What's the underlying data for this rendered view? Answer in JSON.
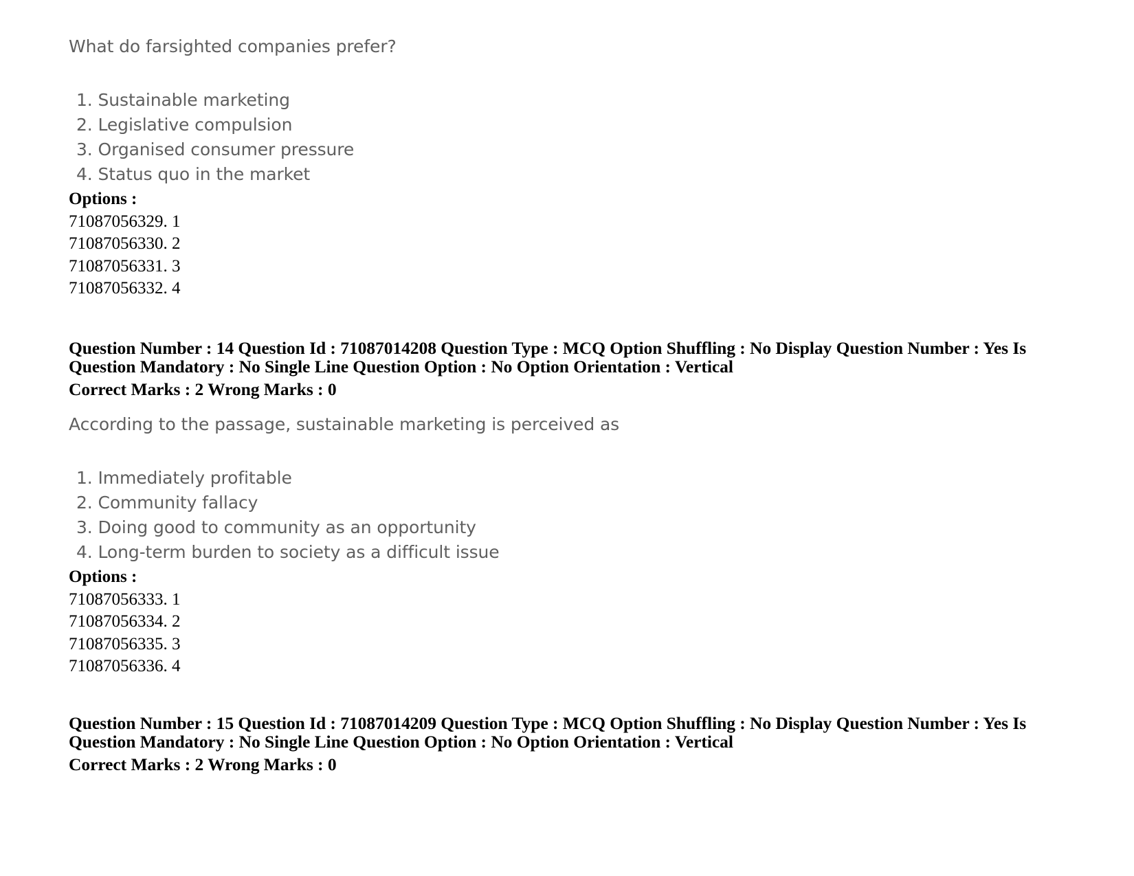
{
  "document": {
    "questions": [
      {
        "stem": "What do farsighted companies prefer?",
        "choices": [
          "1. Sustainable marketing",
          "2. Legislative compulsion",
          "3. Organised consumer pressure",
          "4. Status quo in the market"
        ],
        "options_label": "Options :",
        "option_ids": [
          "71087056329. 1",
          "71087056330. 2",
          "71087056331. 3",
          "71087056332. 4"
        ]
      },
      {
        "stem": "According to the passage, sustainable marketing is perceived as",
        "choices": [
          "1. Immediately profitable",
          "2. Community fallacy",
          "3. Doing good to community as an opportunity",
          "4. Long-term burden to society as a difficult issue"
        ],
        "options_label": "Options :",
        "option_ids": [
          "71087056333. 1",
          "71087056334. 2",
          "71087056335. 3",
          "71087056336. 4"
        ]
      }
    ],
    "meta_blocks": [
      {
        "line1": "Question Number : 14 Question Id : 71087014208 Question Type : MCQ Option Shuffling : No Display Question Number : Yes Is Question Mandatory : No Single Line Question Option : No Option Orientation : Vertical",
        "line2": "Correct Marks : 2 Wrong Marks : 0",
        "fields": {
          "question_number": "14",
          "question_id": "71087014208",
          "question_type": "MCQ",
          "option_shuffling": "No",
          "display_question_number": "Yes",
          "is_question_mandatory": "No",
          "single_line_question_option": "No",
          "option_orientation": "Vertical",
          "correct_marks": "2",
          "wrong_marks": "0"
        }
      },
      {
        "line1": "Question Number : 15 Question Id : 71087014209 Question Type : MCQ Option Shuffling : No Display Question Number : Yes Is Question Mandatory : No Single Line Question Option : No Option Orientation : Vertical",
        "line2": "Correct Marks : 2 Wrong Marks : 0",
        "fields": {
          "question_number": "15",
          "question_id": "71087014209",
          "question_type": "MCQ",
          "option_shuffling": "No",
          "display_question_number": "Yes",
          "is_question_mandatory": "No",
          "single_line_question_option": "No",
          "option_orientation": "Vertical",
          "correct_marks": "2",
          "wrong_marks": "0"
        }
      }
    ]
  }
}
